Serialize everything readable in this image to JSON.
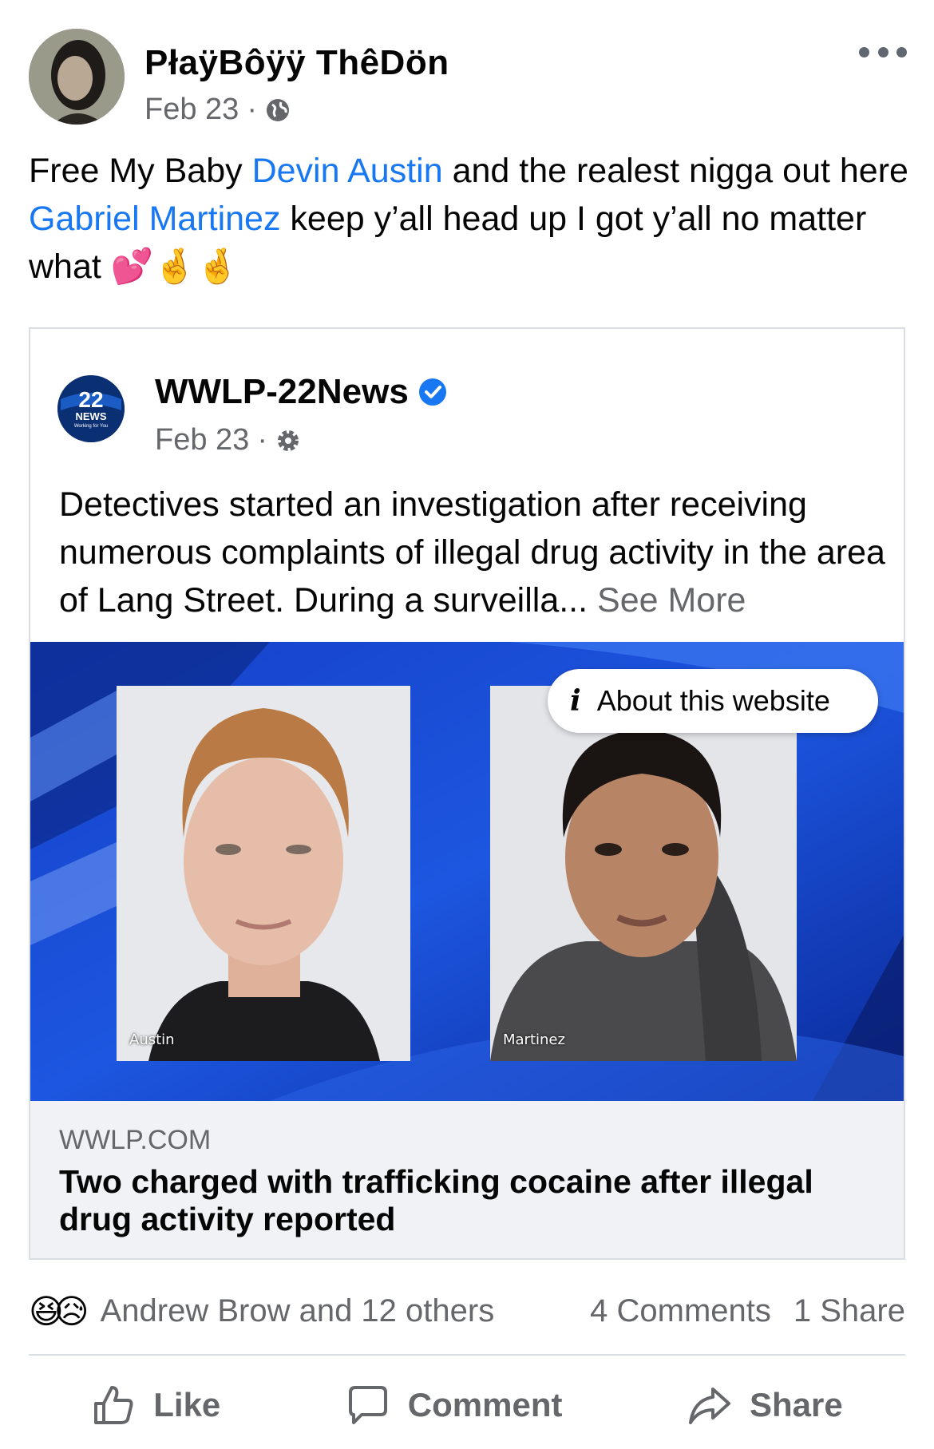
{
  "post": {
    "author": "PłaÿBôÿÿ ThêDön",
    "date": "Feb 23",
    "separator": "·",
    "privacy_icon": "globe-icon",
    "more_icon": "more-horizontal-icon",
    "text": {
      "part1": "Free My Baby ",
      "mention1": "Devin Austin",
      "part2": " and the realest nigga out here ",
      "mention2": "Gabriel Martinez",
      "part3": " keep y’all head up I got y’all no matter what ",
      "emojis": "💕🤞🤞"
    }
  },
  "shared_post": {
    "page_name": "WWLP-22News",
    "verified_icon": "verified-badge-icon",
    "date": "Feb 23",
    "separator": "·",
    "privacy_icon": "gear-icon",
    "logo_number": "22",
    "logo_word": "NEWS",
    "logo_tagline": "Working for You",
    "text": "Detectives started an investigation after receiving numerous complaints of illegal drug activity in the area of Lang Street. During a surveilla...",
    "see_more": "See More",
    "image": {
      "caption_left": "Austin",
      "caption_right": "Martinez",
      "about_label": "About this website",
      "about_icon": "info-icon"
    },
    "link": {
      "domain": "WWLP.COM",
      "headline": "Two charged with trafficking cocaine after illegal drug activity reported"
    }
  },
  "reactions": {
    "icons": [
      "😆",
      "😥"
    ],
    "summary": "Andrew Brow and 12 others",
    "comments": "4 Comments",
    "shares": "1 Share"
  },
  "actions": {
    "like": "Like",
    "comment": "Comment",
    "share": "Share"
  },
  "colors": {
    "link_blue": "#1877f2",
    "secondary_text": "#65676b",
    "divider": "#dadde1",
    "preview_bg": "#f0f2f5"
  }
}
